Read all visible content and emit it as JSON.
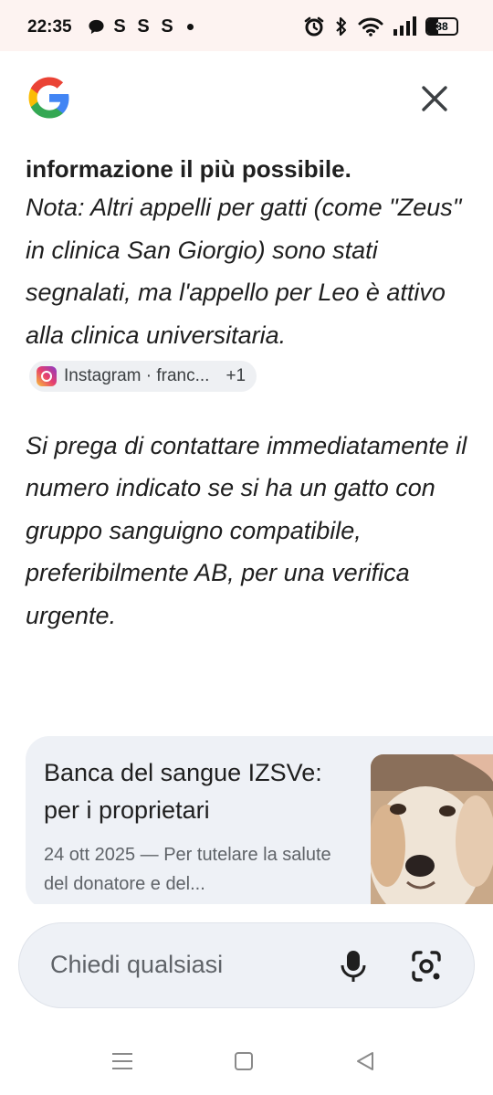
{
  "status_bar": {
    "time": "22:35",
    "notification_icons": [
      "chat-bubble-icon",
      "s-app-icon",
      "s-app-icon",
      "s-app-icon",
      "more-dot-icon"
    ],
    "s_label": "S",
    "battery_level": "38",
    "battery_fraction": 0.38
  },
  "header": {
    "logo_icon": "google-g-logo",
    "close_icon": "close-icon"
  },
  "answer": {
    "bold_line": "informazione il più possibile.",
    "note_text": "Nota: Altri appelli per gatti (come \"Zeus\" in clinica San Giorgio) sono stati segnalati, ma l'appello per Leo è attivo alla clinica universitaria.",
    "source_chip": {
      "icon": "instagram-icon",
      "label": "Instagram · franc...",
      "extra": "+1"
    },
    "request_text": "Si prega di contattare immediatamente il numero indicato se si ha un gatto con gruppo sanguigno compatibile, preferibilmente AB, per una verifica urgente."
  },
  "result_card": {
    "title": "Banca del sangue IZSVe: per i proprietari",
    "snippet": "24 ott 2025 — Per tutelare la salute del donatore e del...",
    "thumbnail": "dog-thumbnail"
  },
  "search_bar": {
    "placeholder": "Chiedi qualsiasi",
    "mic_icon": "microphone-icon",
    "lens_icon": "camera-lens-icon"
  },
  "nav_bar": {
    "items": [
      "menu-icon",
      "home-square-icon",
      "back-triangle-icon"
    ]
  },
  "colors": {
    "status_bar_bg": "#fdf3f1",
    "surface": "#eef1f6",
    "text_primary": "#1f1f1f",
    "text_secondary": "#5f6368"
  }
}
